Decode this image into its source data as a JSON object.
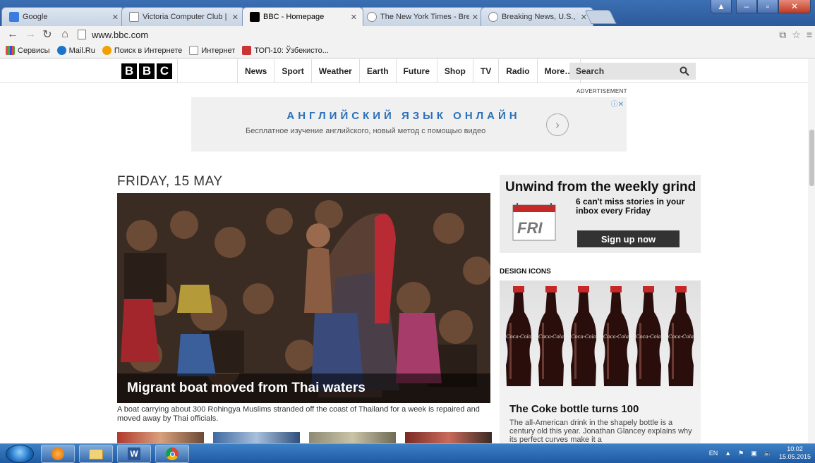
{
  "browser": {
    "tabs": [
      {
        "title": "Google",
        "active": false
      },
      {
        "title": "Victoria Computer Club | ‹",
        "active": false
      },
      {
        "title": "BBC - Homepage",
        "active": true
      },
      {
        "title": "The New York Times - Bre",
        "active": false
      },
      {
        "title": "Breaking News, U.S., Worl",
        "active": false
      }
    ],
    "url": "www.bbc.com",
    "bookmarks": [
      "Сервисы",
      "Mail.Ru",
      "Поиск в Интернете",
      "Интернет",
      "ТОП-10: Ўзбекисто..."
    ]
  },
  "bbc": {
    "logo": [
      "B",
      "B",
      "C"
    ],
    "nav": [
      "News",
      "Sport",
      "Weather",
      "Earth",
      "Future",
      "Shop",
      "TV",
      "Radio",
      "More…"
    ],
    "search_placeholder": "Search"
  },
  "ad": {
    "label": "ADVERTISEMENT",
    "title": "АНГЛИЙСКИЙ ЯЗЫК ОНЛАЙН",
    "subtitle": "Бесплатное изучение английского, новый метод с помощью видео"
  },
  "main": {
    "date": "FRIDAY, 15 MAY",
    "headline": "Migrant boat moved from Thai waters",
    "summary": "A boat carrying about 300 Rohingya Muslims stranded off the coast of Thailand for a week is repaired and moved away by Thai officials."
  },
  "promo": {
    "title": "Unwind from the weekly grind",
    "text": "6 can't miss stories in your inbox every Friday",
    "calendar_day": "FRI",
    "button": "Sign up now"
  },
  "design": {
    "section": "DESIGN ICONS",
    "bottle_label": "Coca-Cola",
    "title": "The Coke bottle turns 100",
    "text": "The all-American drink in the shapely bottle is a century old this year. Jonathan Glancey explains why its perfect curves make it a"
  },
  "taskbar": {
    "lang": "EN",
    "time": "10:02",
    "date": "15.05.2015"
  },
  "colors": {
    "tabstrip": "#2c5a9a",
    "bbc_link": "#2b70b9",
    "taskbar": "#1f5aa3"
  }
}
